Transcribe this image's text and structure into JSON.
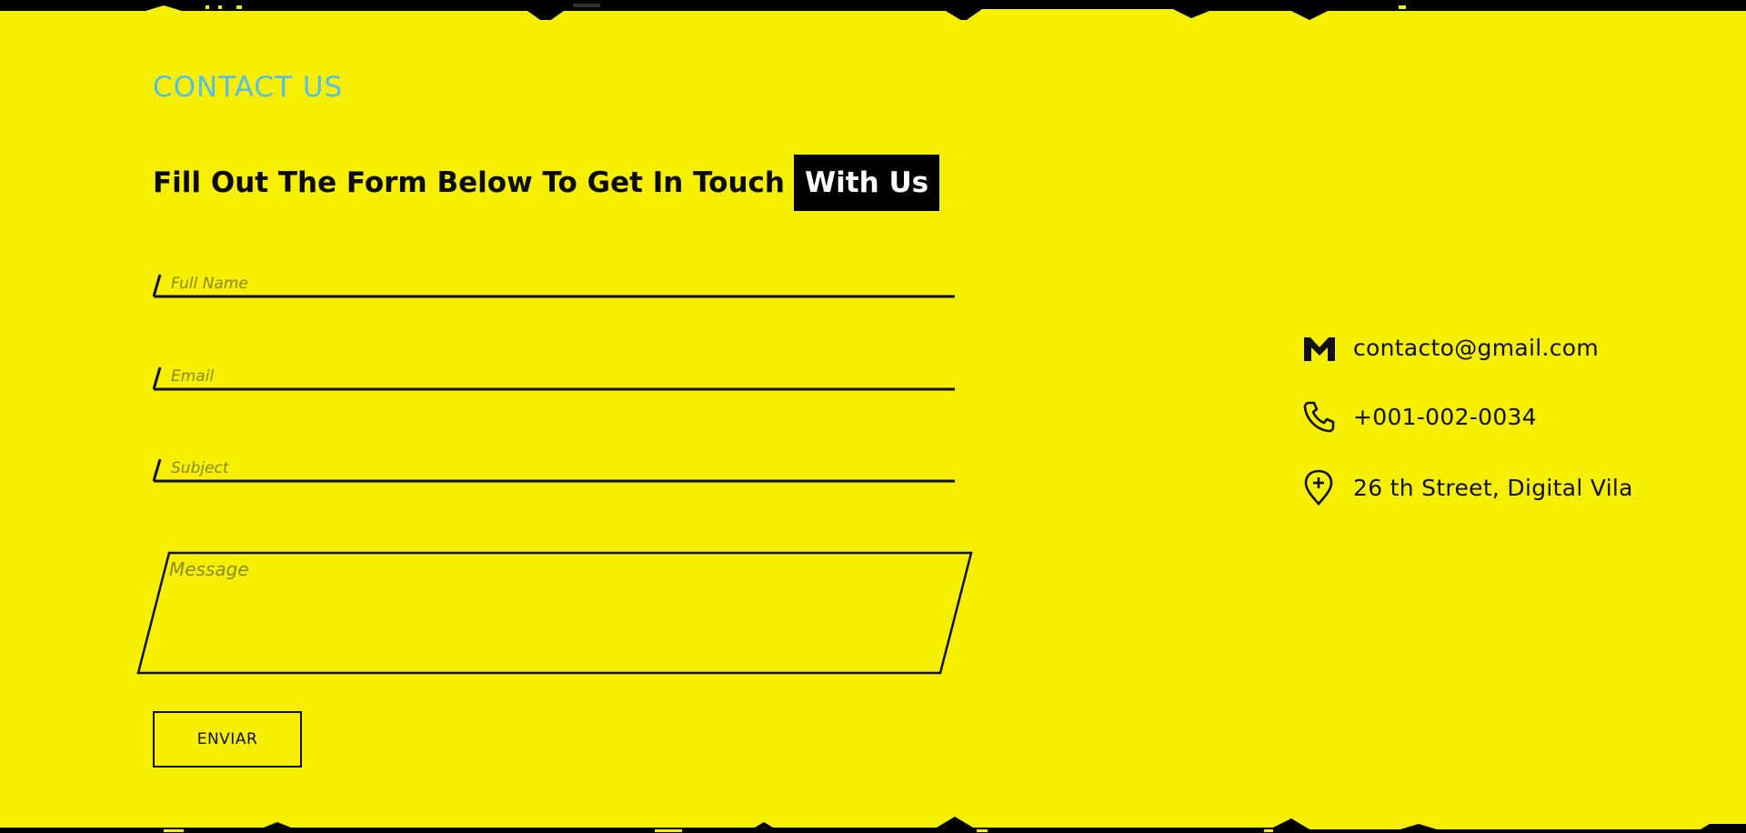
{
  "section_label": "CONTACT US",
  "headline": {
    "main": "Fill Out The Form Below To Get In Touch",
    "highlight": "With Us"
  },
  "form": {
    "full_name_placeholder": "Full Name",
    "email_placeholder": "Email",
    "subject_placeholder": "Subject",
    "message_placeholder": "Message",
    "submit_label": "ENVIAR"
  },
  "contact_info": {
    "email": "contacto@gmail.com",
    "phone": "+001-002-0034",
    "address": "26 th Street, Digital Vila"
  },
  "icons": {
    "email": "gmail-icon",
    "phone": "phone-icon",
    "address": "location-pin-icon"
  },
  "colors": {
    "background": "#f6ef00",
    "accent_label": "#56bfe9",
    "text": "#111111",
    "highlight_bg": "#000000",
    "highlight_text": "#ffffff"
  }
}
